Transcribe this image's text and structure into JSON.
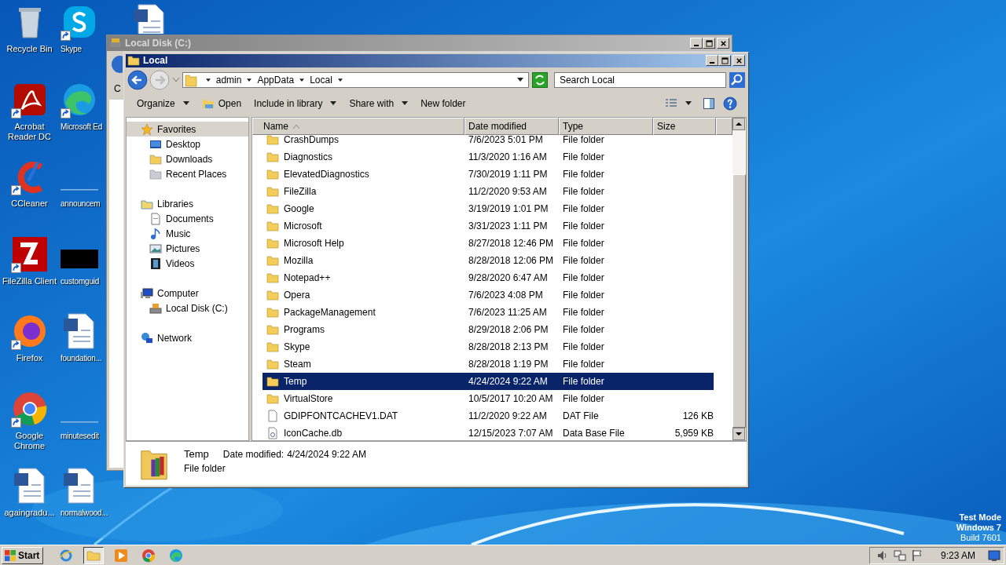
{
  "desktop": {
    "columns": [
      [
        {
          "label": "Recycle Bin",
          "kind": "recycle",
          "shortcut": false
        },
        {
          "label": "Acrobat Reader DC",
          "kind": "acrobat",
          "shortcut": true
        },
        {
          "label": "CCleaner",
          "kind": "ccleaner",
          "shortcut": true
        },
        {
          "label": "FileZilla Client",
          "kind": "filezilla",
          "shortcut": true
        },
        {
          "label": "Firefox",
          "kind": "firefox",
          "shortcut": true
        },
        {
          "label": "Google Chrome",
          "kind": "chrome",
          "shortcut": true
        },
        {
          "label": "againgradu...",
          "kind": "word",
          "shortcut": false
        }
      ],
      [
        {
          "label": "Skype",
          "kind": "skype",
          "shortcut": true
        },
        {
          "label": "Microsoft Ed",
          "kind": "edge",
          "shortcut": true
        },
        {
          "label": "announcem",
          "kind": "line",
          "shortcut": false
        },
        {
          "label": "customguid",
          "kind": "blackbar",
          "shortcut": false
        },
        {
          "label": "foundation...",
          "kind": "word",
          "shortcut": false
        },
        {
          "label": "minutesedit",
          "kind": "line",
          "shortcut": false
        },
        {
          "label": "normalwood...",
          "kind": "word",
          "shortcut": false
        }
      ],
      [
        {
          "kind": "word",
          "shortcut": false
        }
      ]
    ]
  },
  "back_window": {
    "title": "Local Disk (C:)",
    "toolbar_fragment": "C"
  },
  "window": {
    "title": "Local",
    "address": {
      "crumbs": [
        "admin",
        "AppData",
        "Local"
      ]
    },
    "search": {
      "placeholder": "Search Local"
    },
    "toolbar": [
      {
        "label": "Organize",
        "kind": "menu"
      },
      {
        "label": "Open",
        "kind": "open"
      },
      {
        "label": "Include in library",
        "kind": "menu"
      },
      {
        "label": "Share with",
        "kind": "menu"
      },
      {
        "label": "New folder",
        "kind": "plain"
      }
    ],
    "nav": [
      {
        "label": "Favorites",
        "kind": "star",
        "selected": true,
        "children": [
          {
            "label": "Desktop",
            "kind": "desktop",
            "selected": false
          },
          {
            "label": "Downloads",
            "kind": "downloads",
            "selected": false
          },
          {
            "label": "Recent Places",
            "kind": "recent",
            "selected": false
          }
        ]
      },
      {
        "label": "Libraries",
        "kind": "library",
        "selected": false,
        "children": [
          {
            "label": "Documents",
            "kind": "document",
            "selected": false
          },
          {
            "label": "Music",
            "kind": "music",
            "selected": false
          },
          {
            "label": "Pictures",
            "kind": "pictures",
            "selected": false
          },
          {
            "label": "Videos",
            "kind": "videos",
            "selected": false
          }
        ]
      },
      {
        "label": "Computer",
        "kind": "computer",
        "selected": false,
        "children": [
          {
            "label": "Local Disk (C:)",
            "kind": "disk",
            "selected": false
          }
        ]
      },
      {
        "label": "Network",
        "kind": "network",
        "selected": false
      }
    ],
    "columns": [
      {
        "label": "Name",
        "sorted": true
      },
      {
        "label": "Date modified",
        "sorted": false
      },
      {
        "label": "Type",
        "sorted": false
      },
      {
        "label": "Size",
        "sorted": false
      }
    ],
    "rows": [
      {
        "name": "CrashDumps",
        "date": "7/6/2023 5:01 PM",
        "type": "File folder",
        "kind": "folder",
        "selected": false
      },
      {
        "name": "Diagnostics",
        "date": "11/3/2020 1:16 AM",
        "type": "File folder",
        "kind": "folder",
        "selected": false
      },
      {
        "name": "ElevatedDiagnostics",
        "date": "7/30/2019 1:11 PM",
        "type": "File folder",
        "kind": "folder",
        "selected": false
      },
      {
        "name": "FileZilla",
        "date": "11/2/2020 9:53 AM",
        "type": "File folder",
        "kind": "folder",
        "selected": false
      },
      {
        "name": "Google",
        "date": "3/19/2019 1:01 PM",
        "type": "File folder",
        "kind": "folder",
        "selected": false
      },
      {
        "name": "Microsoft",
        "date": "3/31/2023 1:11 PM",
        "type": "File folder",
        "kind": "folder",
        "selected": false
      },
      {
        "name": "Microsoft Help",
        "date": "8/27/2018 12:46 PM",
        "type": "File folder",
        "kind": "folder",
        "selected": false
      },
      {
        "name": "Mozilla",
        "date": "8/28/2018 12:06 PM",
        "type": "File folder",
        "kind": "folder",
        "selected": false
      },
      {
        "name": "Notepad++",
        "date": "9/28/2020 6:47 AM",
        "type": "File folder",
        "kind": "folder",
        "selected": false
      },
      {
        "name": "Opera",
        "date": "7/6/2023 4:08 PM",
        "type": "File folder",
        "kind": "folder",
        "selected": false
      },
      {
        "name": "PackageManagement",
        "date": "7/6/2023 11:25 AM",
        "type": "File folder",
        "kind": "folder",
        "selected": false
      },
      {
        "name": "Programs",
        "date": "8/29/2018 2:06 PM",
        "type": "File folder",
        "kind": "folder",
        "selected": false
      },
      {
        "name": "Skype",
        "date": "8/28/2018 2:13 PM",
        "type": "File folder",
        "kind": "folder",
        "selected": false
      },
      {
        "name": "Steam",
        "date": "8/28/2018 1:19 PM",
        "type": "File folder",
        "kind": "folder",
        "selected": false
      },
      {
        "name": "Temp",
        "date": "4/24/2024 9:22 AM",
        "type": "File folder",
        "kind": "folder",
        "selected": true
      },
      {
        "name": "VirtualStore",
        "date": "10/5/2017 10:20 AM",
        "type": "File folder",
        "kind": "folder",
        "selected": false
      },
      {
        "name": "GDIPFONTCACHEV1.DAT",
        "date": "11/2/2020 9:22 AM",
        "type": "DAT File",
        "size": "126 KB",
        "kind": "file",
        "selected": false
      },
      {
        "name": "IconCache.db",
        "date": "12/15/2023 7:07 AM",
        "type": "Data Base File",
        "size": "5,959 KB",
        "kind": "db",
        "selected": false
      }
    ],
    "details": {
      "name": "Temp",
      "date_label": "Date modified:",
      "date": "4/24/2024 9:22 AM",
      "type": "File folder"
    }
  },
  "taskbar": {
    "start": "Start",
    "apps": [
      {
        "kind": "ie",
        "active": false
      },
      {
        "kind": "explorer",
        "active": true
      },
      {
        "kind": "media",
        "active": false
      },
      {
        "kind": "chrome",
        "active": false
      },
      {
        "kind": "edge",
        "active": false
      }
    ],
    "clock": "9:23 AM"
  },
  "test_mode": {
    "line_1": "Test Mode",
    "line_2": "Windows 7",
    "line_3": "Build 7601"
  }
}
